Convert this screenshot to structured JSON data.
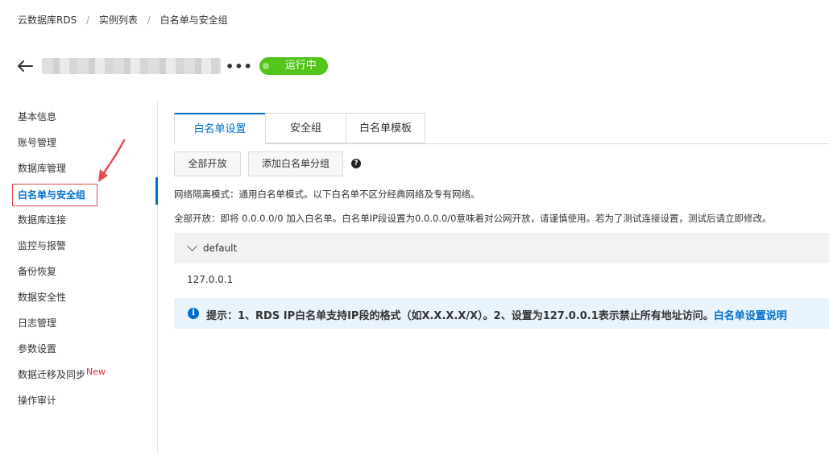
{
  "breadcrumb": [
    "云数据库RDS",
    "实例列表",
    "白名单与安全组"
  ],
  "breadcrumb_sep": "/",
  "header": {
    "more": "•••",
    "status": "运行中"
  },
  "sidebar": {
    "items": [
      {
        "label": "基本信息"
      },
      {
        "label": "账号管理"
      },
      {
        "label": "数据库管理"
      },
      {
        "label": "白名单与安全组"
      },
      {
        "label": "数据库连接"
      },
      {
        "label": "监控与报警"
      },
      {
        "label": "备份恢复"
      },
      {
        "label": "数据安全性"
      },
      {
        "label": "日志管理"
      },
      {
        "label": "参数设置"
      },
      {
        "label": "数据迁移及同步",
        "badge": "New"
      },
      {
        "label": "操作审计"
      }
    ]
  },
  "tabs": [
    "白名单设置",
    "安全组",
    "白名单模板"
  ],
  "toolbar": {
    "open_all": "全部开放",
    "add_group": "添加白名单分组",
    "help": "?"
  },
  "info": {
    "network_mode": "网络隔离模式：通用白名单模式。以下白名单不区分经典网络及专有网络。",
    "open_all_note": "全部开放：即将 0.0.0.0/0 加入白名单。白名单IP段设置为0.0.0.0/0意味着对公网开放，请谨慎使用。若为了测试连接设置，测试后请立即修改。"
  },
  "group": {
    "name": "default",
    "ip": "127.0.0.1"
  },
  "tip": {
    "icon": "i",
    "text": "提示：1、RDS IP白名单支持IP段的格式（如X.X.X.X/X）。2、设置为127.0.0.1表示禁止所有地址访问。",
    "link": "白名单设置说明"
  },
  "colors": {
    "accent": "#0070cc",
    "status": "#52c41a",
    "annotation": "#e34a4a"
  }
}
